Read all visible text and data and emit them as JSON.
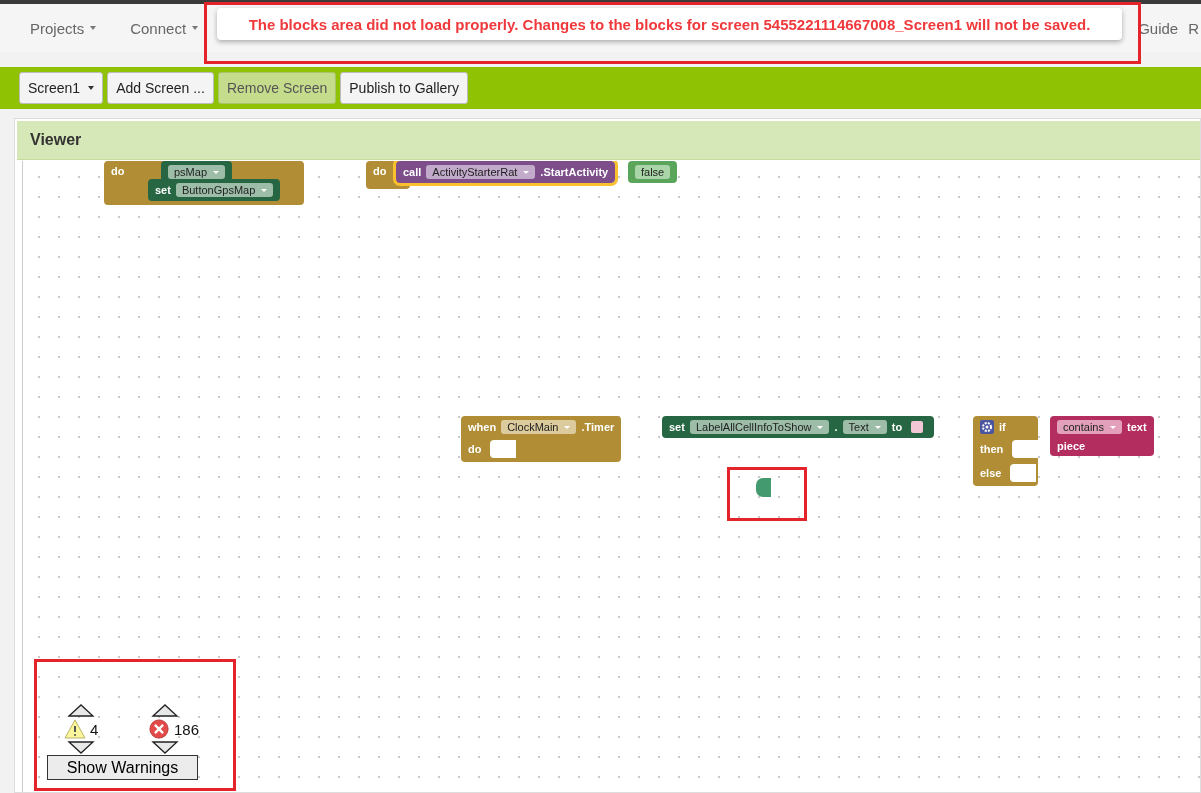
{
  "nav": [
    {
      "label": "Projects",
      "dropdown": true
    },
    {
      "label": "Connect",
      "dropdown": true
    },
    {
      "label": "Guide",
      "dropdown": false
    },
    {
      "label": "R",
      "dropdown": false
    }
  ],
  "toast": {
    "message": "The blocks area did not load properly. Changes to the blocks for screen 5455221114667008_Screen1 will not be saved."
  },
  "toolbar": [
    {
      "label": "Screen1",
      "dropdown": true,
      "disabled": false
    },
    {
      "label": "Add Screen ...",
      "dropdown": false,
      "disabled": false
    },
    {
      "label": "Remove Screen",
      "dropdown": false,
      "disabled": true
    },
    {
      "label": "Publish to Gallery",
      "dropdown": false,
      "disabled": false
    }
  ],
  "viewer": {
    "title": "Viewer"
  },
  "blocks": [
    {
      "kind": "control",
      "selected": false,
      "rows": [
        [
          {
            "kind": "label",
            "text": "do"
          }
        ]
      ]
    },
    {
      "kind": "setter",
      "selected": false,
      "rows": [
        [
          {
            "kind": "dropdown",
            "text": "psMap"
          }
        ]
      ]
    },
    {
      "kind": "setter",
      "selected": false,
      "rows": [
        [
          {
            "kind": "label",
            "text": "set"
          },
          {
            "kind": "dropdown",
            "text": "ButtonGpsMap"
          }
        ]
      ]
    },
    {
      "kind": "control",
      "selected": false,
      "rows": [
        [
          {
            "kind": "label",
            "text": "do"
          }
        ]
      ]
    },
    {
      "kind": "call",
      "selected": true,
      "rows": [
        [
          {
            "kind": "label",
            "text": "call"
          },
          {
            "kind": "dropdown",
            "text": "ActivityStarterRat"
          },
          {
            "kind": "label",
            "text": ".StartActivity"
          }
        ]
      ]
    },
    {
      "kind": "logic",
      "selected": false,
      "rows": [
        [
          {
            "kind": "pill",
            "text": "false"
          }
        ]
      ]
    },
    {
      "kind": "control",
      "selected": false,
      "rows": [
        [
          {
            "kind": "label",
            "text": "when"
          },
          {
            "kind": "dropdown",
            "text": "ClockMain"
          },
          {
            "kind": "label",
            "text": ".Timer"
          }
        ],
        [
          {
            "kind": "label",
            "text": "do"
          }
        ]
      ]
    },
    {
      "kind": "setter",
      "selected": false,
      "rows": [
        [
          {
            "kind": "label",
            "text": "set"
          },
          {
            "kind": "dropdown",
            "text": "LabelAllCellInfoToShow"
          },
          {
            "kind": "label",
            "text": "."
          },
          {
            "kind": "dropdown",
            "text": "Text"
          },
          {
            "kind": "label",
            "text": "to"
          },
          {
            "kind": "string"
          }
        ]
      ]
    },
    {
      "kind": "control",
      "selected": false,
      "rows": [
        [
          {
            "kind": "gear"
          },
          {
            "kind": "label",
            "text": "if"
          }
        ],
        [
          {
            "kind": "label",
            "text": "then"
          }
        ],
        [
          {
            "kind": "label",
            "text": "else"
          }
        ]
      ]
    },
    {
      "kind": "text",
      "selected": false,
      "rows": [
        [
          {
            "kind": "dropdown",
            "text": "contains"
          },
          {
            "kind": "label",
            "text": "text"
          }
        ],
        [
          {
            "kind": "label",
            "text": "piece"
          }
        ]
      ]
    }
  ],
  "warnings": {
    "warning_count": "4",
    "error_count": "186",
    "button": "Show Warnings"
  }
}
